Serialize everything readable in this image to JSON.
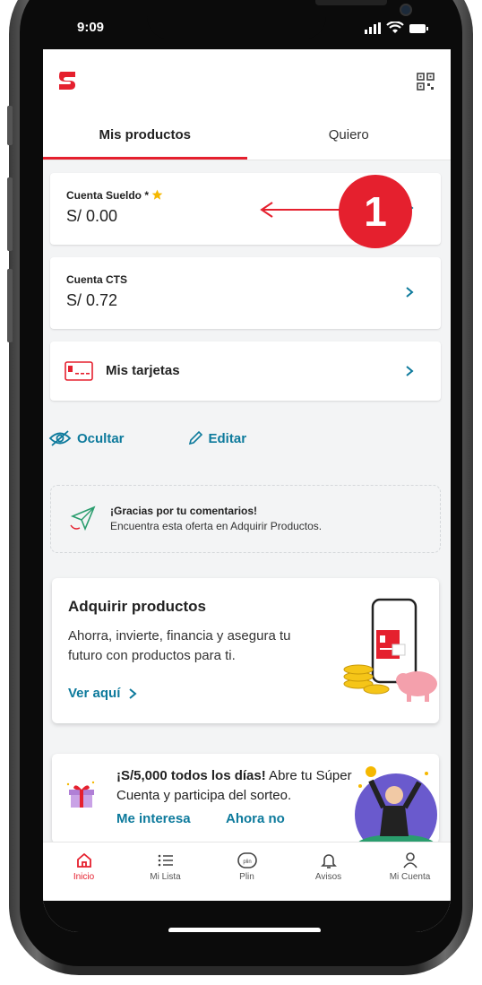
{
  "status": {
    "time": "9:09"
  },
  "tabs": [
    {
      "label": "Mis productos"
    },
    {
      "label": "Quiero"
    }
  ],
  "accounts": [
    {
      "name": "Cuenta Sueldo *",
      "balance": "S/ 0.00"
    },
    {
      "name": "Cuenta CTS",
      "balance": "S/ 0.72"
    }
  ],
  "cards_row": {
    "label": "Mis tarjetas"
  },
  "actions": {
    "hide": "Ocultar",
    "edit": "Editar"
  },
  "feedback": {
    "title": "¡Gracias por tu comentarios!",
    "subtitle": "Encuentra esta oferta en Adquirir Productos."
  },
  "promo": {
    "title": "Adquirir productos",
    "body": "Ahorra, invierte, financia y asegura tu futuro con productos para ti.",
    "link": "Ver aquí"
  },
  "promo2": {
    "headline_bold": "¡S/5,000 todos los días!",
    "headline_rest": " Abre tu Súper Cuenta y participa del sorteo.",
    "btn_yes": "Me interesa",
    "btn_no": "Ahora no"
  },
  "bottom_nav": [
    {
      "label": "Inicio"
    },
    {
      "label": "Mi Lista"
    },
    {
      "label": "Plin"
    },
    {
      "label": "Avisos"
    },
    {
      "label": "Mi Cuenta"
    }
  ],
  "annotation": {
    "number": "1"
  },
  "colors": {
    "brand_red": "#e5202e",
    "link_teal": "#0d7a9c",
    "star": "#f5b800"
  }
}
